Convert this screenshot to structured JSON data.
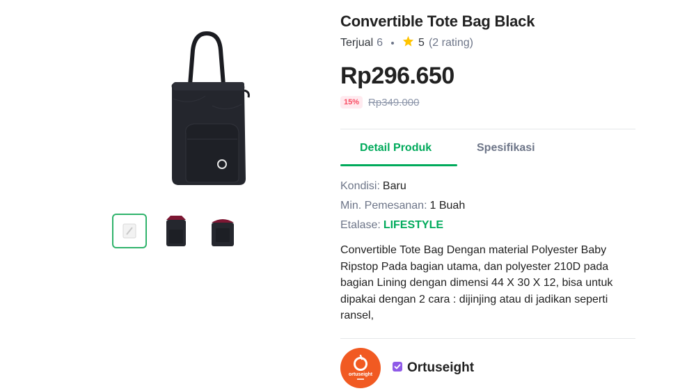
{
  "product": {
    "title": "Convertible Tote Bag Black",
    "sold_label": "Terjual",
    "sold_count": "6",
    "rating_value": "5",
    "rating_count": "(2 rating)",
    "price": "Rp296.650",
    "discount_badge": "15%",
    "original_price": "Rp349.000"
  },
  "tabs": [
    {
      "label": "Detail Produk",
      "active": true
    },
    {
      "label": "Spesifikasi",
      "active": false
    }
  ],
  "details": {
    "condition_label": "Kondisi:",
    "condition_value": "Baru",
    "min_order_label": "Min. Pemesanan:",
    "min_order_value": "1 Buah",
    "showcase_label": "Etalase:",
    "showcase_value": "LIFESTYLE"
  },
  "description": "Convertible Tote Bag Dengan material Polyester Baby Ripstop Pada bagian utama, dan polyester 210D pada bagian Lining dengan dimensi 44 X 30 X 12, bisa untuk dipakai dengan 2 cara : dijinjing atau di jadikan seperti ransel,",
  "shop": {
    "name": "Ortuseight",
    "logo_text": "ortuseight",
    "badge_icon": "verified-shop-badge-icon"
  },
  "colors": {
    "accent_green": "#00aa5b",
    "discount_red": "#f94d63",
    "shop_logo_orange": "#f15a22",
    "badge_purple": "#8f5ae8",
    "star_yellow": "#ffc400"
  },
  "gallery": {
    "thumbnail_count": 3,
    "selected_index": 0
  }
}
